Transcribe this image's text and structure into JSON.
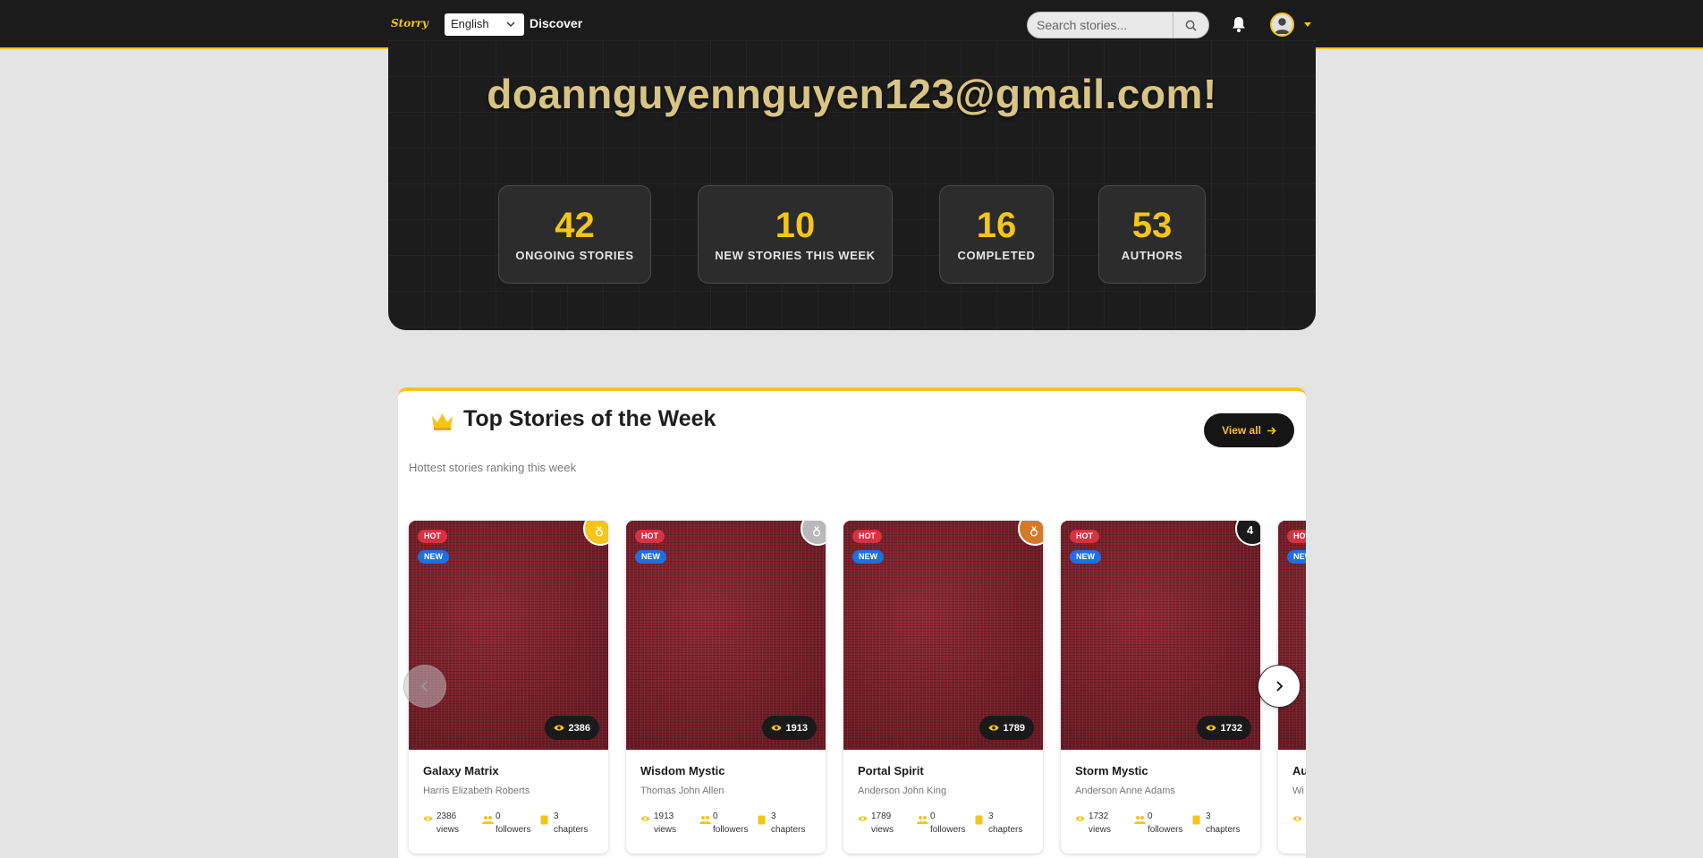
{
  "navbar": {
    "logo": "Storry",
    "language": "English",
    "discover": "Discover",
    "search_placeholder": "Search stories..."
  },
  "hero": {
    "title": "doannguyennguyen123@gmail.com!",
    "stats": [
      {
        "value": "42",
        "label": "ONGOING STORIES"
      },
      {
        "value": "10",
        "label": "NEW STORIES THIS WEEK"
      },
      {
        "value": "16",
        "label": "COMPLETED"
      },
      {
        "value": "53",
        "label": "AUTHORS"
      }
    ]
  },
  "top_stories": {
    "title": "Top Stories of the Week",
    "subtitle": "Hottest stories ranking this week",
    "view_all": "View all",
    "badges": {
      "hot": "HOT",
      "new": "NEW"
    },
    "stories": [
      {
        "title": "Galaxy Matrix",
        "author": "Harris Elizabeth Roberts",
        "views": "2386",
        "views_label": "views",
        "followers": "0",
        "followers_label": "followers",
        "chapters": "3",
        "chapters_label": "chapters",
        "rank": "",
        "rank_color": "#f5c518"
      },
      {
        "title": "Wisdom Mystic",
        "author": "Thomas John Allen",
        "views": "1913",
        "views_label": "views",
        "followers": "0",
        "followers_label": "followers",
        "chapters": "3",
        "chapters_label": "chapters",
        "rank": "",
        "rank_color": "#b9b9b9"
      },
      {
        "title": "Portal Spirit",
        "author": "Anderson John King",
        "views": "1789",
        "views_label": "views",
        "followers": "0",
        "followers_label": "followers",
        "chapters": "3",
        "chapters_label": "chapters",
        "rank": "",
        "rank_color": "#d47a2c"
      },
      {
        "title": "Storm Mystic",
        "author": "Anderson Anne Adams",
        "views": "1732",
        "views_label": "views",
        "followers": "0",
        "followers_label": "followers",
        "chapters": "3",
        "chapters_label": "chapters",
        "rank": "4",
        "rank_color": "#1a1a1a"
      },
      {
        "title": "Au",
        "author": "Wi",
        "views": "",
        "views_label": "",
        "followers": "",
        "followers_label": "",
        "chapters": "",
        "chapters_label": "",
        "rank": "",
        "rank_color": "#1a1a1a"
      }
    ]
  },
  "colors": {
    "accent": "#f5c518",
    "hot": "#d63342",
    "new": "#1f6fe0",
    "navbar": "#1b1b1b"
  }
}
